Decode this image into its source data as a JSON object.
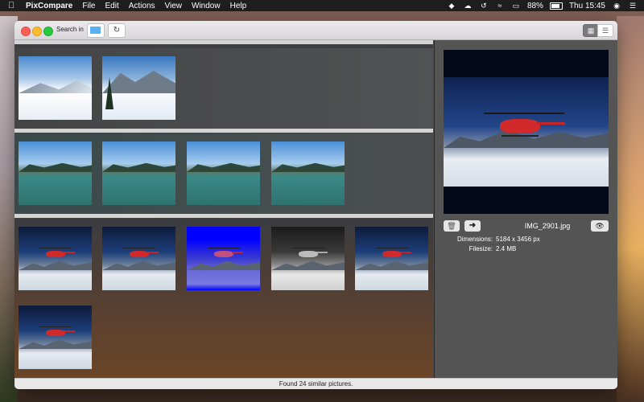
{
  "menubar": {
    "app_name": "PixCompare",
    "menus": [
      "File",
      "Edit",
      "Actions",
      "View",
      "Window",
      "Help"
    ],
    "battery": "88%",
    "clock": "Thu 15:45"
  },
  "toolbar": {
    "search_label": "Search in",
    "folder_icon": "folder-icon",
    "refresh_icon": "refresh-icon"
  },
  "groups": [
    {
      "thumbs": [
        "snow",
        "snow-trees"
      ]
    },
    {
      "thumbs": [
        "lake",
        "lake",
        "lake",
        "lake"
      ]
    },
    {
      "thumbs": [
        "heli",
        "heli",
        "heli-blue",
        "heli-gray",
        "heli",
        "heli"
      ]
    }
  ],
  "preview": {
    "filename": "IMG_2901.jpg",
    "dimensions_label": "Dimensions:",
    "dimensions_value": "5184 x 3456 px",
    "filesize_label": "Filesize:",
    "filesize_value": "2.4 MB"
  },
  "status": {
    "text": "Found 24 similar pictures."
  },
  "colors": {
    "accent_blue": "#5ab0f0",
    "heli_red": "#d12a2a"
  }
}
